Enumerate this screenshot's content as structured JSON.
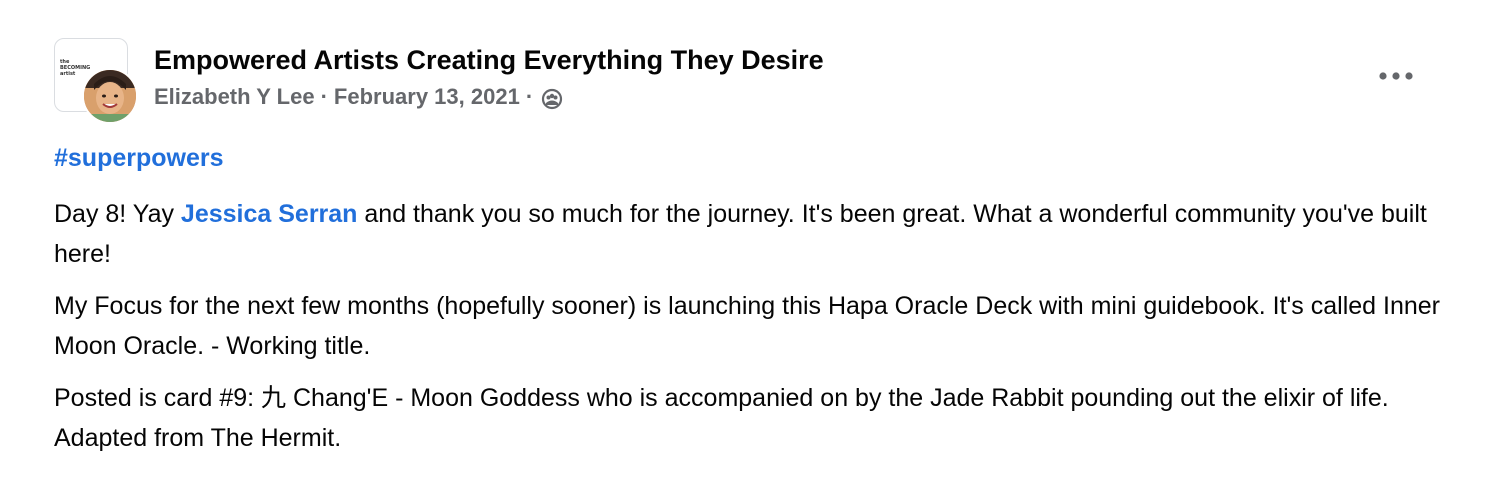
{
  "group": {
    "name": "Empowered Artists Creating Everything They Desire",
    "thumb_text": "the BECOMING artist"
  },
  "post": {
    "author": "Elizabeth Y Lee",
    "separator": "·",
    "date": "February 13, 2021",
    "audience_icon": "group-audience-icon",
    "more_icon": "more-options-icon",
    "hashtag": "#superpowers",
    "paragraph1": {
      "before": "Day 8! Yay ",
      "mention": "Jessica Serran",
      "after": " and thank you so much for the journey. It's been great. What a wonderful community you've built here!"
    },
    "paragraph2": "My Focus for the next few months (hopefully sooner) is launching this Hapa Oracle Deck with mini guidebook. It's called Inner Moon Oracle. - Working title.",
    "paragraph3": "Posted is card #9:  九 Chang'E - Moon Goddess who is accompanied on by the Jade Rabbit pounding out the elixir of life. Adapted from The Hermit."
  },
  "colors": {
    "link": "#216fdb",
    "meta": "#65676b",
    "text": "#050505"
  }
}
